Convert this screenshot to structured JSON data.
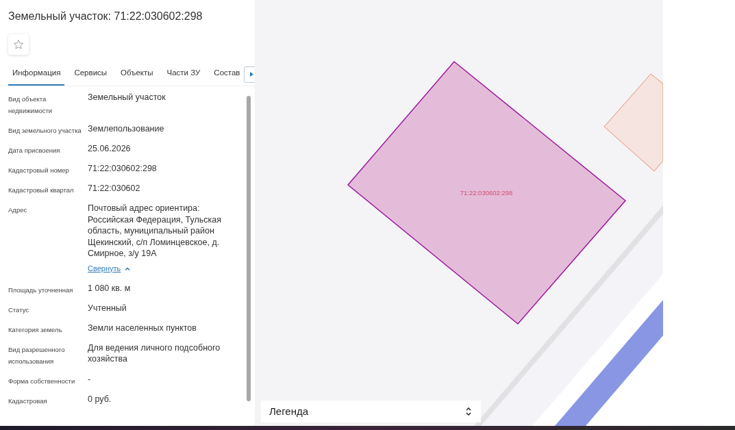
{
  "panel": {
    "title": "Земельный участок: 71:22:030602:298",
    "favorite": false,
    "tabs": [
      {
        "label": "Информация",
        "selected": true
      },
      {
        "label": "Сервисы",
        "selected": false
      },
      {
        "label": "Объекты",
        "selected": false
      },
      {
        "label": "Части ЗУ",
        "selected": false
      },
      {
        "label": "Состав",
        "selected": false
      }
    ],
    "fields": [
      {
        "label": "Вид объекта недвижимости",
        "value": "Земельный участок"
      },
      {
        "label": "Вид земельного участка",
        "value": "Землепользование"
      },
      {
        "label": "Дата присвоения",
        "value": "25.06.2026"
      },
      {
        "label": "Кадастровый номер",
        "value": "71:22:030602:298"
      },
      {
        "label": "Кадастровый квартал",
        "value": "71:22:030602"
      },
      {
        "label": "Адрес",
        "value": "Почтовый адрес ориентира: Российская Федерация, Тульская область, муниципальный район Щекинский, с/п Ломинцевское, д. Смирное, з/у 19А",
        "toggle": "Свернуть"
      },
      {
        "label": "Площадь уточненная",
        "value": "1 080 кв. м"
      },
      {
        "label": "Статус",
        "value": "Учтенный"
      },
      {
        "label": "Категория земель",
        "value": "Земли населенных пунктов"
      },
      {
        "label": "Вид разрешенного использования",
        "value": "Для ведения личного подсобного хозяйства"
      },
      {
        "label": "Форма собственности",
        "value": "-"
      },
      {
        "label": "Кадастровая",
        "value": "0 руб."
      }
    ]
  },
  "map": {
    "parcel_label": "71:22:030602:298",
    "legend": "Легенда"
  }
}
